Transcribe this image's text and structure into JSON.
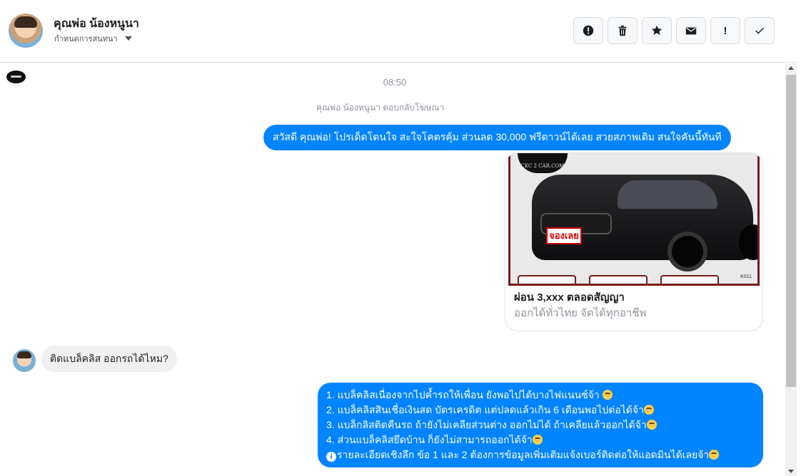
{
  "header": {
    "contact_name": "คุณพ่อ น้องหนูนา",
    "status_label": "กำหนดการสนทนา",
    "actions": [
      {
        "icon": "alert-circle-icon"
      },
      {
        "icon": "trash-icon"
      },
      {
        "icon": "star-icon"
      },
      {
        "icon": "envelope-icon"
      },
      {
        "icon": "exclamation-icon",
        "label": "!"
      },
      {
        "icon": "check-icon"
      }
    ]
  },
  "thread": {
    "timestamp": "08:50",
    "reply_note": "คุณพ่อ น้องหนูนา ตอบกลับโฆษณา",
    "messages": {
      "outgoing_1": "สวัสดี คุณพ่อ! โปรเด็ดโดนใจ สะใจโคตรคุ้ม ส่วนลด 30,000 ฟรีดาวน์ได้เลย สวยสภาพเดิม สนใจคันนี้ทันที",
      "ad_card": {
        "image_logo_text": "CKC 2 CAR.COM",
        "image_stamp_text": "จองเลย",
        "image_code": "K011",
        "title": "ผ่อน 3,xxx ตลอดสัญญา",
        "subtitle": "ออกได้ทั่วไทย จัดได้ทุกอาชีพ"
      },
      "incoming_1": "ติดแบล็คลิส ออกรถได้ไหม?",
      "outgoing_2": {
        "lines": [
          "1. แบล็คลิสเนื่องจากไปค้ำรถให้เพื่อน ยังพอไปได้บางไฟแนนซ์จ้า ",
          "2. แบล็คลิสสินเชื่อเงินสด บัตรเครดิต แต่ปลดแล้วเกิน 6 เดือนพอไปต่อได้จ้า",
          "3. แบล็กลิสติดคืนรถ ถ้ายังไม่เคลียส่วนต่าง ออกไม่ได้ ถ้าเคลียแล้วออกได้จ้า",
          "4. ส่วนแบล็คลิสยึดบ้าน ก็ยังไม่สามารถออกได้จ้า",
          "รายละเอียดเชิงลึก ข้อ 1 และ 2 ต้องการข้อมูลเพิ่มเติมแจ้งเบอร์ติดต่อให้แอดมินได้เลยจ้า"
        ],
        "info_icon_label": "i"
      }
    }
  },
  "colors": {
    "outgoing_bubble": "#0084ff",
    "incoming_bubble": "#f1f0f0",
    "meta_text": "#90949c"
  }
}
